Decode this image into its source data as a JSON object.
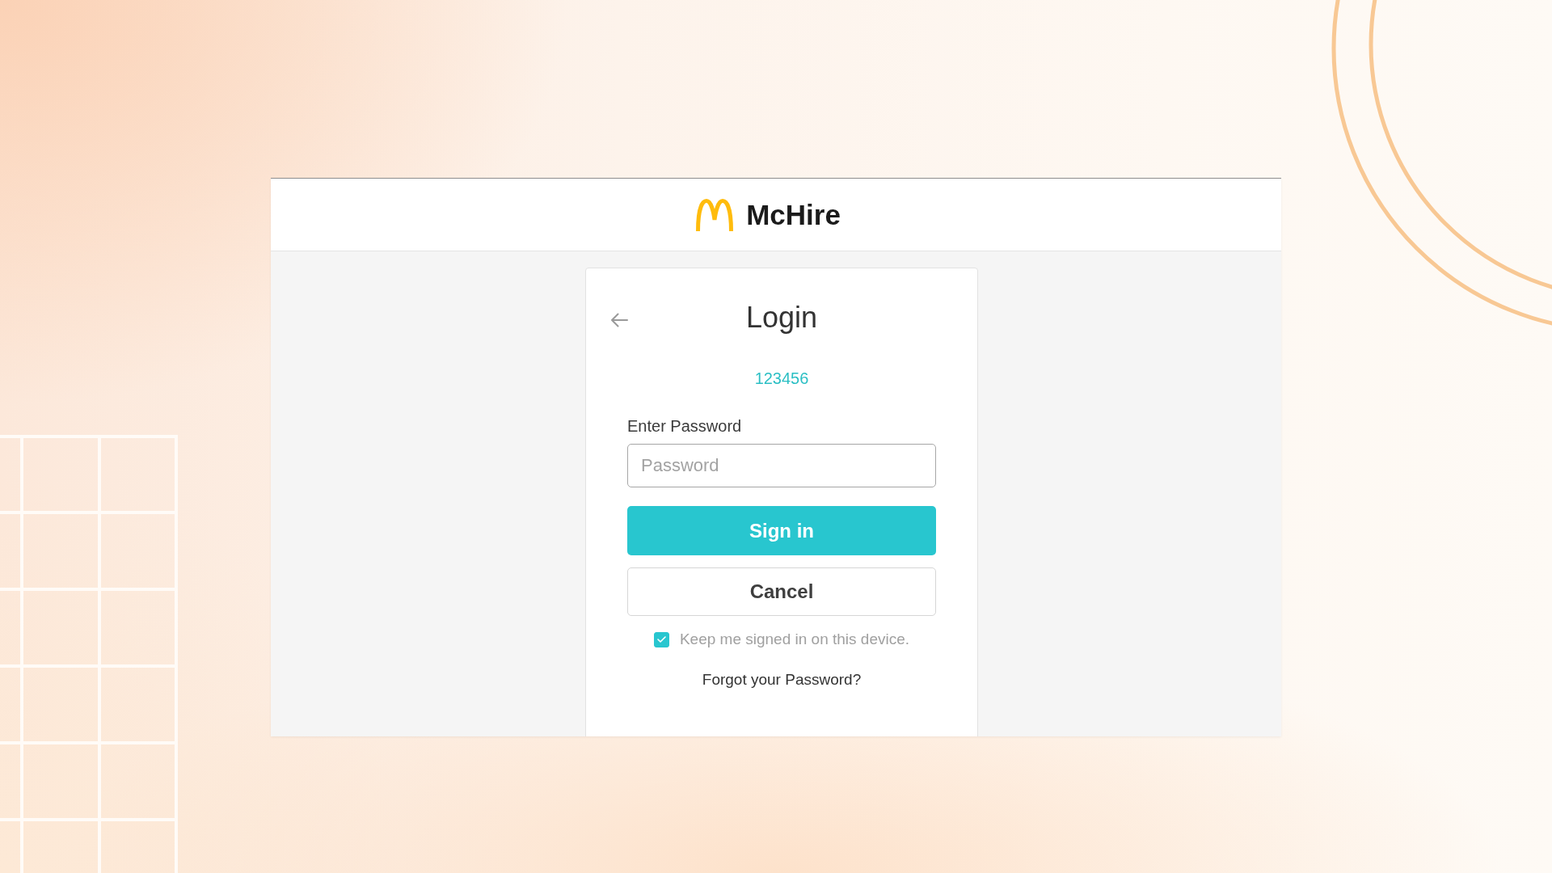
{
  "header": {
    "brand": "McHire"
  },
  "login": {
    "title": "Login",
    "account_id": "123456",
    "password": {
      "label": "Enter Password",
      "placeholder": "Password"
    },
    "buttons": [
      {
        "label": "Sign in",
        "kind": "primary"
      },
      {
        "label": "Cancel",
        "kind": "secondary"
      }
    ],
    "keep_signed_in": {
      "label": "Keep me signed in on this device.",
      "checked": true
    },
    "forgot_link": "Forgot your Password?"
  }
}
